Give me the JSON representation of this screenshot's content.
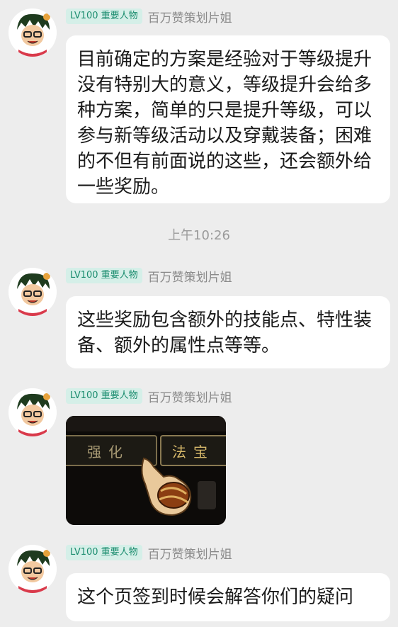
{
  "messages": [
    {
      "badge": "LV100 重要人物",
      "sender": "百万赞策划片姐",
      "text": "目前确定的方案是经验对于等级提升没有特别大的意义，等级提升会给多种方案，简单的只是提升等级，可以参与新等级活动以及穿戴装备；困难的不但有前面说的这些，还会额外给一些奖励。"
    },
    {
      "badge": "LV100 重要人物",
      "sender": "百万赞策划片姐",
      "text": "这些奖励包含额外的技能点、特性装备、额外的属性点等等。"
    },
    {
      "badge": "LV100 重要人物",
      "sender": "百万赞策划片姐",
      "image": {
        "left_button": "强化",
        "right_button": "法宝"
      }
    },
    {
      "badge": "LV100 重要人物",
      "sender": "百万赞策划片姐",
      "text": "这个页签到时候会解答你们的疑问"
    }
  ],
  "timestamp": "上午10:26",
  "colors": {
    "background": "#ededed",
    "bubble": "#ffffff",
    "badge_bg": "#d5efe8",
    "badge_text": "#1c8d6f",
    "sender": "#8a8a8a"
  }
}
